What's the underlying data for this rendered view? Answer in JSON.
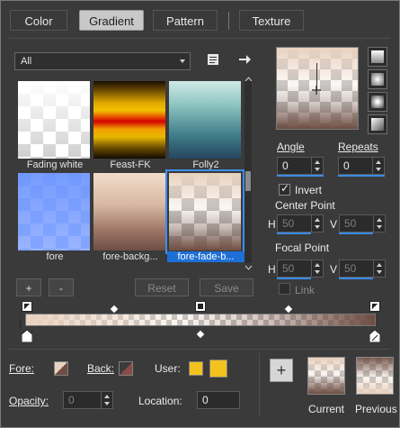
{
  "tabs": [
    {
      "label": "Color",
      "active": false
    },
    {
      "label": "Gradient",
      "active": true
    },
    {
      "label": "Pattern",
      "active": false
    },
    {
      "label": "Texture",
      "active": false
    }
  ],
  "library": {
    "filter_value": "All",
    "items": [
      {
        "label": "Fading white",
        "selected": false
      },
      {
        "label": "Feast-FK",
        "selected": false
      },
      {
        "label": "Folly2",
        "selected": false
      },
      {
        "label": "fore",
        "selected": false
      },
      {
        "label": "fore-backg...",
        "selected": false
      },
      {
        "label": "fore-fade-b...",
        "selected": true
      }
    ]
  },
  "list_buttons": {
    "add": "+",
    "remove": "-",
    "reset": "Reset",
    "save": "Save"
  },
  "settings": {
    "angle_label": "Angle",
    "angle_value": "0",
    "repeats_label": "Repeats",
    "repeats_value": "0",
    "invert_label": "Invert",
    "invert_checked": true,
    "center_point_label": "Center Point",
    "center_h_label": "H",
    "center_h_value": "50",
    "center_v_label": "V",
    "center_v_value": "50",
    "focal_point_label": "Focal Point",
    "focal_h_label": "H",
    "focal_h_value": "50",
    "focal_v_label": "V",
    "focal_v_value": "50",
    "link_label": "Link",
    "link_checked": false
  },
  "bottom": {
    "fore_label": "Fore:",
    "back_label": "Back:",
    "user_label": "User:",
    "opacity_label": "Opacity:",
    "opacity_value": "0",
    "location_label": "Location:",
    "location_value": "0",
    "add_swatch": "+",
    "current_label": "Current",
    "previous_label": "Previous"
  },
  "colors": {
    "accent": "#3b8be6",
    "user_color": "#f2c21e",
    "tan": "#e9d2bf",
    "brown": "#6e4e43"
  }
}
